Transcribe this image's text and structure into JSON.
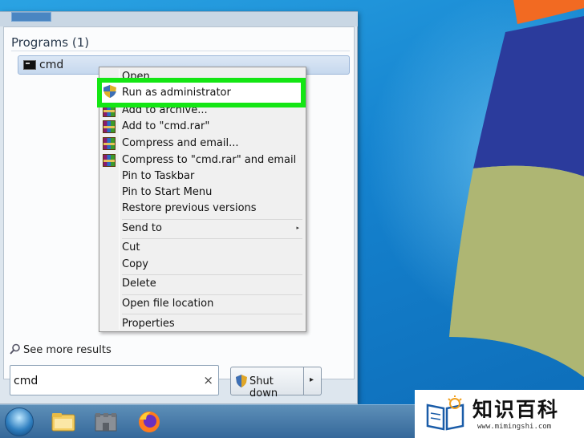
{
  "start_menu": {
    "programs_header": "Programs (1)",
    "program_item": "cmd",
    "see_more": "See more results",
    "search": {
      "value": "cmd",
      "clear_glyph": "×"
    },
    "shutdown_label": "Shut down",
    "shutdown_arrow_glyph": "▸"
  },
  "context_menu": {
    "items": [
      {
        "label": "Open",
        "icon": ""
      },
      {
        "label": "Run as administrator",
        "icon": "uac-shield-icon"
      },
      {
        "label": "Add to archive...",
        "icon": "winrar-icon"
      },
      {
        "label": "Add to \"cmd.rar\"",
        "icon": "winrar-icon"
      },
      {
        "label": "Compress and email...",
        "icon": "winrar-icon"
      },
      {
        "label": "Compress to \"cmd.rar\" and email",
        "icon": "winrar-icon"
      },
      {
        "label": "Pin to Taskbar",
        "icon": ""
      },
      {
        "label": "Pin to Start Menu",
        "icon": ""
      },
      {
        "label": "Restore previous versions",
        "icon": ""
      },
      {
        "label": "Send to",
        "icon": ""
      },
      {
        "label": "Cut",
        "icon": ""
      },
      {
        "label": "Copy",
        "icon": ""
      },
      {
        "label": "Delete",
        "icon": ""
      },
      {
        "label": "Open file location",
        "icon": ""
      },
      {
        "label": "Properties",
        "icon": ""
      }
    ],
    "submenu_arrow_glyph": "▸",
    "highlight_color": "#14e614"
  },
  "taskbar": {
    "items": [
      "start-orb",
      "windows-explorer-icon",
      "app-icon",
      "firefox-icon"
    ]
  },
  "watermark": {
    "title": "知识百科",
    "url": "www.mimingshi.com"
  }
}
